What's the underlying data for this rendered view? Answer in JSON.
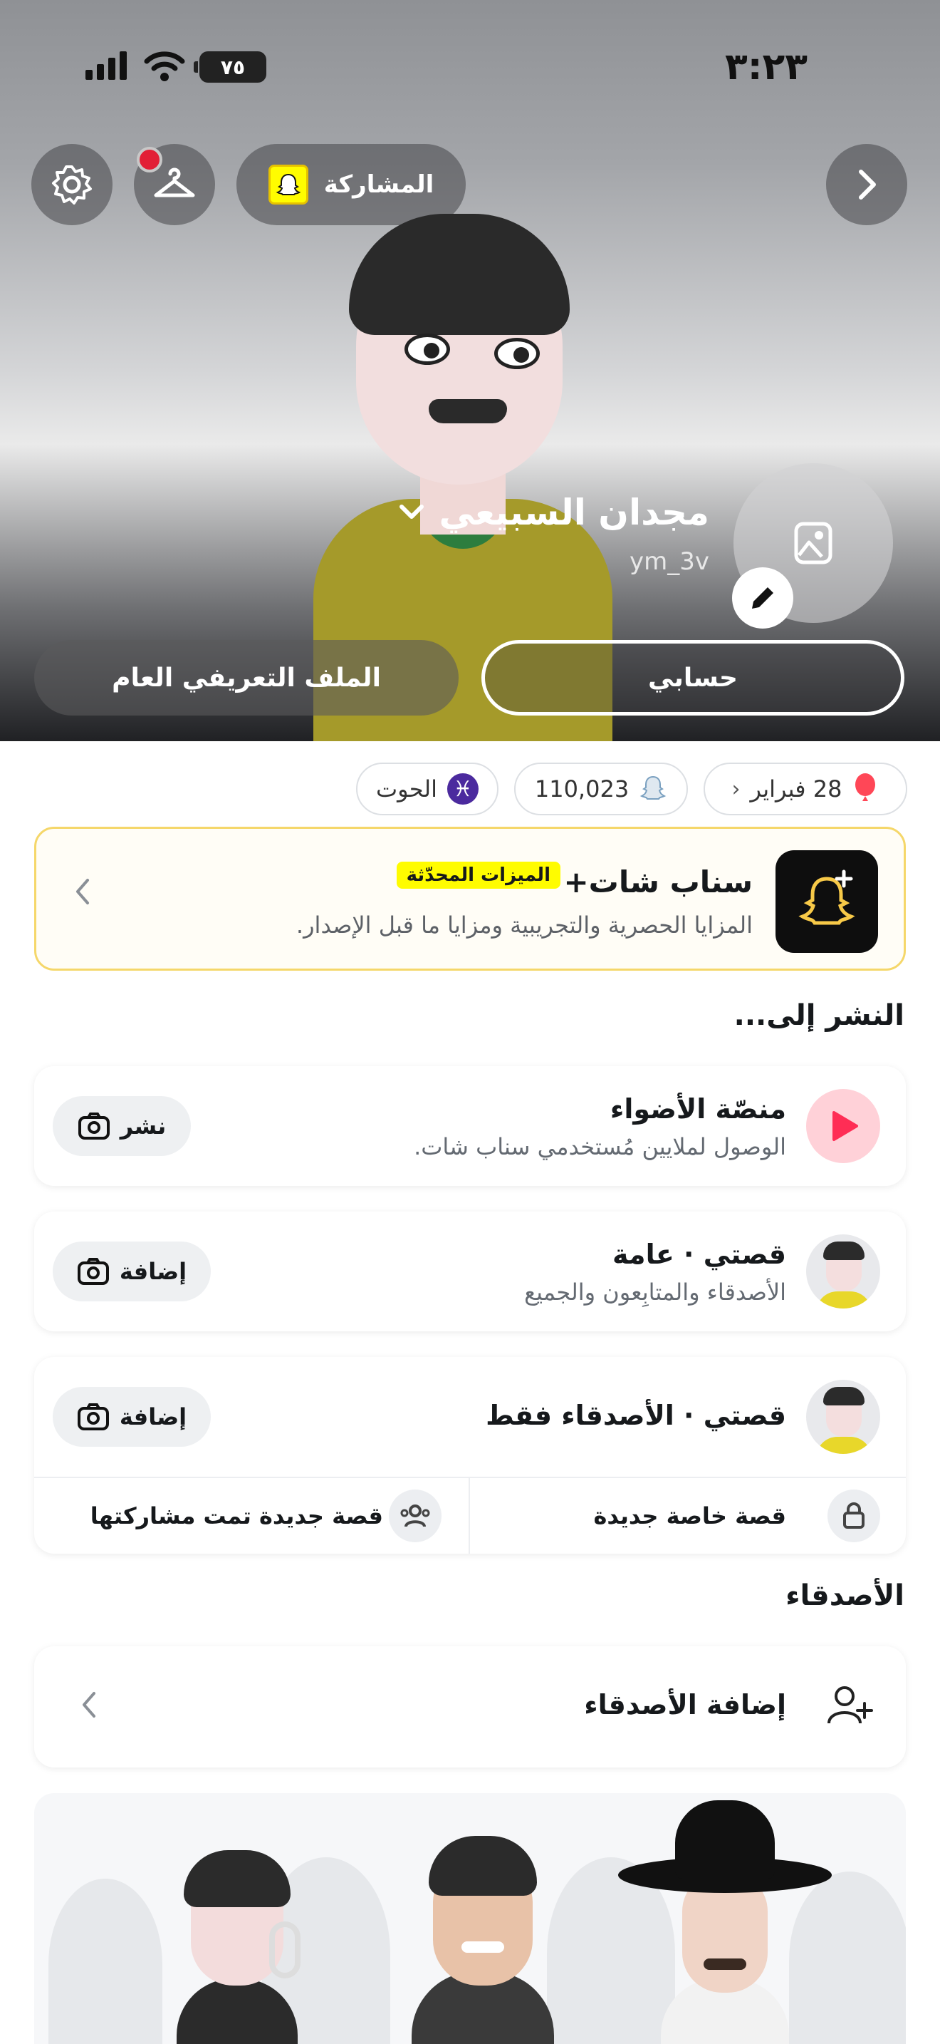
{
  "status_bar": {
    "time": "٣:٢٣",
    "battery": "٧٥"
  },
  "header": {
    "share_label": "المشاركة",
    "display_name": "مجدان السبيعي",
    "username": "ym_3v",
    "tabs": {
      "my_account": "حسابي",
      "public_profile": "الملف التعريفي العام"
    }
  },
  "chips": [
    {
      "text": "28 فبراير",
      "icon": "balloon-icon"
    },
    {
      "text": "110,023",
      "icon": "snap-score-icon"
    },
    {
      "text": "الحوت",
      "icon": "pisces-icon"
    }
  ],
  "snapchat_plus": {
    "title": "سناب شات+",
    "badge": "الميزات المحدّثة",
    "subtitle": "المزايا الحصرية والتجريبية ومزايا ما قبل الإصدار."
  },
  "post_to": {
    "section_title": "النشر إلى...",
    "spotlight": {
      "title": "منصّة الأضواء",
      "subtitle": "الوصول لملايين مُستخدمي سناب شات.",
      "action": "نشر"
    },
    "public_story": {
      "title": "قصتي · عامة",
      "subtitle": "الأصدقاء والمتابِعون والجميع",
      "action": "إضافة"
    },
    "friends_story": {
      "title": "قصتي · الأصدقاء فقط",
      "action": "إضافة"
    },
    "new_private_story": "قصة خاصة جديدة",
    "new_shared_story": "قصة جديدة تمت مشاركتها"
  },
  "friends": {
    "section_title": "الأصدقاء",
    "add_friends": "إضافة الأصدقاء"
  },
  "colors": {
    "accent_red": "#e21f36",
    "snap_yellow": "#fffc00",
    "spotlight_red": "#ff2d55"
  }
}
